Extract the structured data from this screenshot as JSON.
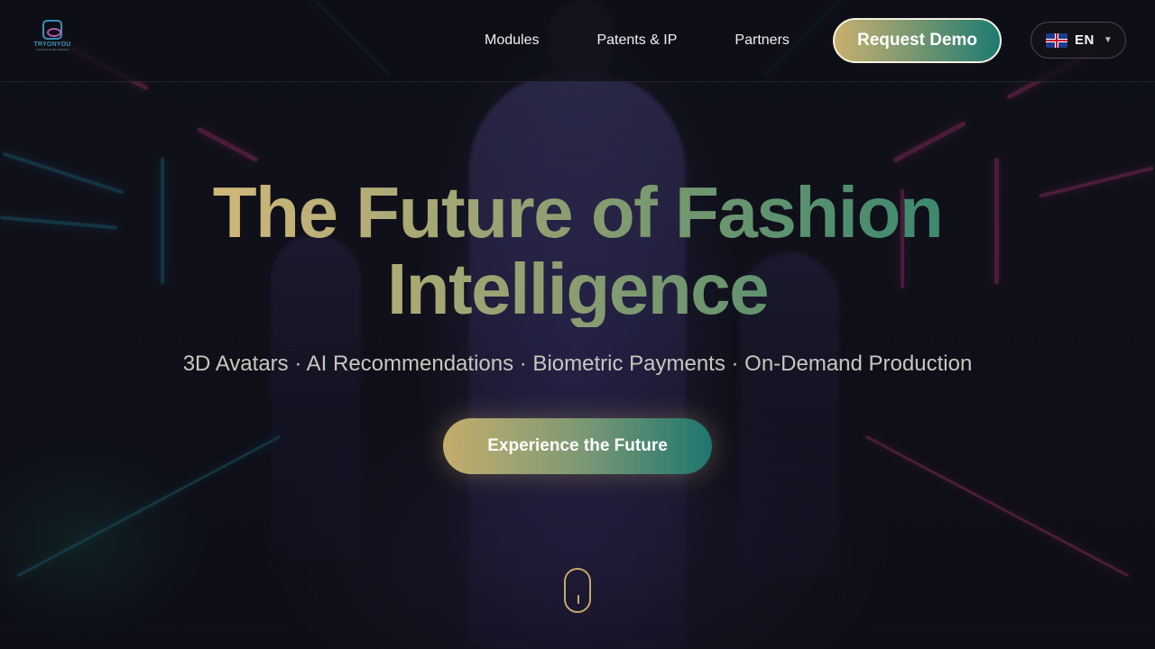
{
  "brand": {
    "logo_text": "TRYONYOU",
    "logo_sub": "FASHION INTELLIGENCE"
  },
  "nav": {
    "links": [
      {
        "label": "Modules"
      },
      {
        "label": "Patents & IP"
      },
      {
        "label": "Partners"
      }
    ],
    "demo_label": "Request Demo",
    "language": {
      "code": "EN",
      "flag": "uk-flag-icon"
    }
  },
  "hero": {
    "title_line1": "The Future of Fashion",
    "title_line2": "Intelligence",
    "subtitle": "3D Avatars · AI Recommendations · Biometric Payments · On-Demand Production",
    "cta_label": "Experience the Future"
  },
  "colors": {
    "gold": "#c9b06e",
    "teal": "#1e7a72",
    "background": "#0d0f14"
  }
}
